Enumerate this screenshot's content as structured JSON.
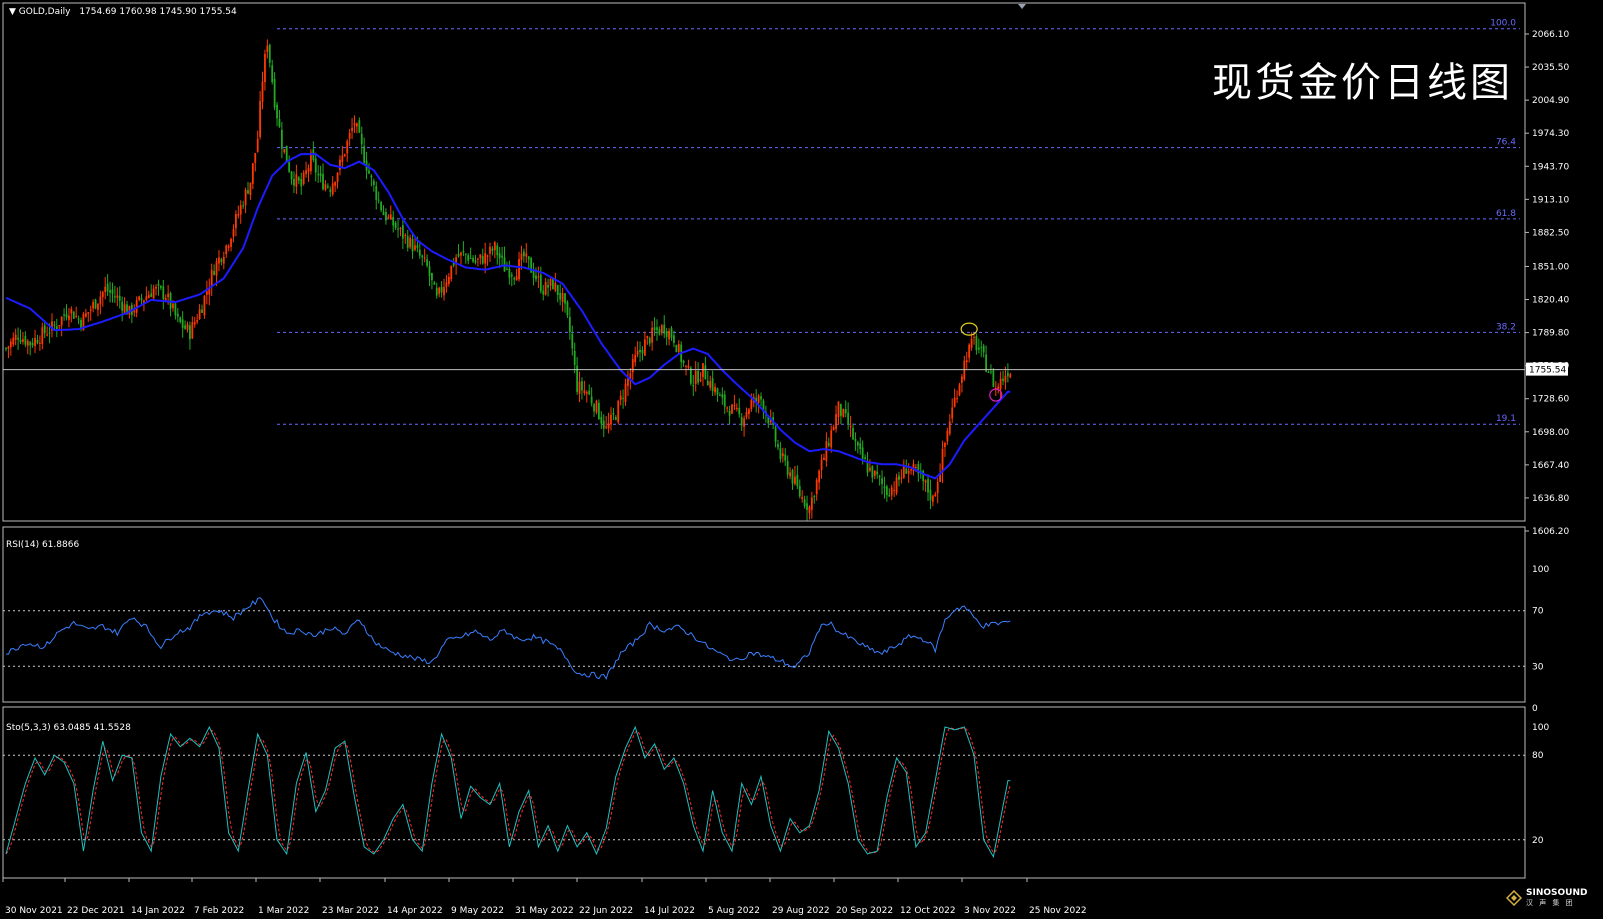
{
  "header": {
    "symbol_label": "GOLD,Daily",
    "ohlc": "1754.69 1760.98 1745.90 1755.54"
  },
  "watermark": "现货金价日线图",
  "logo": {
    "name": "SINOSOUND",
    "sub": "汉 声 集 团"
  },
  "rsi": {
    "label": "RSI(14) 61.8866",
    "levels": [
      30,
      70
    ],
    "max": 100,
    "min": 0
  },
  "stoch": {
    "label": "Sto(5,3,3) 63.0485 41.5528",
    "levels": [
      20,
      80
    ],
    "max": 100
  },
  "colors": {
    "up_candle": "#ff3a00",
    "down_candle": "#22aa22",
    "ma": "#1c1cff",
    "fib": "#6a6aff",
    "rsi": "#3a7fff",
    "stoch_main": "#20c0c0",
    "stoch_signal": "#ff2a2a",
    "price_line": "#c0c0c0"
  },
  "chart_data": {
    "type": "line",
    "title": "现货金价日线图",
    "current_price": 1755.54,
    "current_price_label": "1755.54",
    "price_axis": {
      "ylim": [
        1598,
        2074
      ],
      "ticks": [
        2066.1,
        2035.5,
        2004.9,
        1974.3,
        1943.7,
        1913.1,
        1882.5,
        1851.0,
        1820.4,
        1789.8,
        1759.2,
        1728.6,
        1698.0,
        1667.4,
        1636.8,
        1606.2
      ],
      "tick_labels": [
        "2066.10",
        "2035.50",
        "2004.90",
        "1974.30",
        "1943.70",
        "1913.10",
        "1882.50",
        "1851.00",
        "1820.40",
        "1789.80",
        "1759.20",
        "1728.60",
        "1698.00",
        "1667.40",
        "1636.80",
        "1606.20"
      ]
    },
    "x_tick_labels": [
      "30 Nov 2021",
      "22 Dec 2021",
      "14 Jan 2022",
      "7 Feb 2022",
      "1 Mar 2022",
      "23 Mar 2022",
      "14 Apr 2022",
      "9 May 2022",
      "31 May 2022",
      "22 Jun 2022",
      "14 Jul 2022",
      "5 Aug 2022",
      "29 Aug 2022",
      "20 Sep 2022",
      "12 Oct 2022",
      "3 Nov 2022",
      "25 Nov 2022"
    ],
    "fibonacci": [
      {
        "label": "100.0",
        "price": 2071
      },
      {
        "label": "76.4",
        "price": 1961
      },
      {
        "label": "61.8",
        "price": 1895
      },
      {
        "label": "38.2",
        "price": 1790
      },
      {
        "label": "19.1",
        "price": 1705
      }
    ],
    "price_anchors": [
      [
        0,
        1775
      ],
      [
        5,
        1788
      ],
      [
        10,
        1780
      ],
      [
        16,
        1790
      ],
      [
        21,
        1797
      ],
      [
        26,
        1812
      ],
      [
        31,
        1800
      ],
      [
        36,
        1815
      ],
      [
        41,
        1830
      ],
      [
        46,
        1822
      ],
      [
        51,
        1808
      ],
      [
        56,
        1820
      ],
      [
        61,
        1830
      ],
      [
        66,
        1825
      ],
      [
        71,
        1800
      ],
      [
        76,
        1790
      ],
      [
        81,
        1815
      ],
      [
        86,
        1850
      ],
      [
        91,
        1870
      ],
      [
        96,
        1900
      ],
      [
        101,
        1930
      ],
      [
        104,
        1970
      ],
      [
        106,
        2025
      ],
      [
        108,
        2060
      ],
      [
        111,
        2005
      ],
      [
        114,
        1965
      ],
      [
        118,
        1935
      ],
      [
        122,
        1925
      ],
      [
        126,
        1950
      ],
      [
        130,
        1930
      ],
      [
        134,
        1925
      ],
      [
        138,
        1945
      ],
      [
        141,
        1965
      ],
      [
        144,
        1985
      ],
      [
        147,
        1960
      ],
      [
        151,
        1930
      ],
      [
        156,
        1900
      ],
      [
        162,
        1885
      ],
      [
        168,
        1870
      ],
      [
        174,
        1850
      ],
      [
        178,
        1820
      ],
      [
        182,
        1840
      ],
      [
        186,
        1860
      ],
      [
        190,
        1862
      ],
      [
        194,
        1855
      ],
      [
        198,
        1860
      ],
      [
        202,
        1868
      ],
      [
        206,
        1850
      ],
      [
        210,
        1845
      ],
      [
        214,
        1860
      ],
      [
        218,
        1845
      ],
      [
        222,
        1830
      ],
      [
        226,
        1835
      ],
      [
        230,
        1820
      ],
      [
        233,
        1790
      ],
      [
        236,
        1740
      ],
      [
        240,
        1735
      ],
      [
        244,
        1720
      ],
      [
        248,
        1700
      ],
      [
        252,
        1715
      ],
      [
        256,
        1740
      ],
      [
        260,
        1765
      ],
      [
        264,
        1780
      ],
      [
        268,
        1790
      ],
      [
        272,
        1795
      ],
      [
        276,
        1785
      ],
      [
        280,
        1760
      ],
      [
        284,
        1745
      ],
      [
        288,
        1755
      ],
      [
        292,
        1740
      ],
      [
        296,
        1725
      ],
      [
        300,
        1718
      ],
      [
        304,
        1710
      ],
      [
        308,
        1725
      ],
      [
        312,
        1728
      ],
      [
        316,
        1705
      ],
      [
        320,
        1675
      ],
      [
        324,
        1660
      ],
      [
        328,
        1640
      ],
      [
        332,
        1628
      ],
      [
        336,
        1660
      ],
      [
        340,
        1690
      ],
      [
        344,
        1720
      ],
      [
        348,
        1705
      ],
      [
        352,
        1680
      ],
      [
        356,
        1665
      ],
      [
        360,
        1655
      ],
      [
        364,
        1643
      ],
      [
        368,
        1650
      ],
      [
        372,
        1665
      ],
      [
        376,
        1660
      ],
      [
        380,
        1648
      ],
      [
        383,
        1635
      ],
      [
        386,
        1665
      ],
      [
        390,
        1710
      ],
      [
        394,
        1745
      ],
      [
        397,
        1770
      ],
      [
        400,
        1782
      ],
      [
        403,
        1770
      ],
      [
        406,
        1755
      ],
      [
        409,
        1738
      ],
      [
        412,
        1748
      ],
      [
        414,
        1755
      ]
    ],
    "ma_anchors": [
      [
        0,
        1822
      ],
      [
        10,
        1812
      ],
      [
        20,
        1792
      ],
      [
        30,
        1793
      ],
      [
        40,
        1800
      ],
      [
        50,
        1808
      ],
      [
        60,
        1820
      ],
      [
        70,
        1818
      ],
      [
        80,
        1825
      ],
      [
        90,
        1840
      ],
      [
        98,
        1868
      ],
      [
        104,
        1905
      ],
      [
        110,
        1935
      ],
      [
        116,
        1948
      ],
      [
        122,
        1955
      ],
      [
        128,
        1955
      ],
      [
        134,
        1945
      ],
      [
        140,
        1942
      ],
      [
        146,
        1948
      ],
      [
        152,
        1940
      ],
      [
        158,
        1920
      ],
      [
        164,
        1895
      ],
      [
        170,
        1875
      ],
      [
        176,
        1865
      ],
      [
        182,
        1858
      ],
      [
        190,
        1850
      ],
      [
        198,
        1848
      ],
      [
        206,
        1852
      ],
      [
        214,
        1850
      ],
      [
        222,
        1845
      ],
      [
        230,
        1835
      ],
      [
        238,
        1810
      ],
      [
        246,
        1780
      ],
      [
        254,
        1755
      ],
      [
        260,
        1742
      ],
      [
        266,
        1748
      ],
      [
        272,
        1760
      ],
      [
        278,
        1770
      ],
      [
        284,
        1775
      ],
      [
        290,
        1770
      ],
      [
        296,
        1755
      ],
      [
        302,
        1742
      ],
      [
        308,
        1730
      ],
      [
        314,
        1715
      ],
      [
        320,
        1700
      ],
      [
        326,
        1688
      ],
      [
        332,
        1680
      ],
      [
        338,
        1682
      ],
      [
        344,
        1680
      ],
      [
        350,
        1675
      ],
      [
        356,
        1670
      ],
      [
        362,
        1668
      ],
      [
        368,
        1668
      ],
      [
        374,
        1665
      ],
      [
        380,
        1658
      ],
      [
        384,
        1655
      ],
      [
        390,
        1668
      ],
      [
        396,
        1690
      ],
      [
        402,
        1705
      ],
      [
        408,
        1720
      ],
      [
        414,
        1735
      ]
    ],
    "rsi_anchors": [
      [
        0,
        39
      ],
      [
        8,
        47
      ],
      [
        16,
        44
      ],
      [
        22,
        55
      ],
      [
        28,
        61
      ],
      [
        34,
        56
      ],
      [
        40,
        59
      ],
      [
        46,
        54
      ],
      [
        52,
        66
      ],
      [
        58,
        58
      ],
      [
        64,
        44
      ],
      [
        70,
        54
      ],
      [
        76,
        58
      ],
      [
        82,
        69
      ],
      [
        88,
        70
      ],
      [
        94,
        65
      ],
      [
        100,
        73
      ],
      [
        106,
        79
      ],
      [
        110,
        65
      ],
      [
        116,
        54
      ],
      [
        122,
        56
      ],
      [
        128,
        52
      ],
      [
        134,
        58
      ],
      [
        140,
        53
      ],
      [
        146,
        64
      ],
      [
        152,
        48
      ],
      [
        158,
        41
      ],
      [
        164,
        38
      ],
      [
        170,
        35
      ],
      [
        176,
        33
      ],
      [
        182,
        48
      ],
      [
        188,
        51
      ],
      [
        194,
        55
      ],
      [
        200,
        49
      ],
      [
        206,
        56
      ],
      [
        212,
        49
      ],
      [
        218,
        51
      ],
      [
        224,
        47
      ],
      [
        230,
        40
      ],
      [
        236,
        25
      ],
      [
        242,
        24
      ],
      [
        248,
        22
      ],
      [
        254,
        39
      ],
      [
        260,
        48
      ],
      [
        266,
        60
      ],
      [
        272,
        56
      ],
      [
        278,
        58
      ],
      [
        284,
        52
      ],
      [
        290,
        44
      ],
      [
        296,
        38
      ],
      [
        302,
        34
      ],
      [
        308,
        40
      ],
      [
        314,
        37
      ],
      [
        320,
        34
      ],
      [
        326,
        29
      ],
      [
        332,
        40
      ],
      [
        336,
        57
      ],
      [
        340,
        62
      ],
      [
        344,
        55
      ],
      [
        350,
        49
      ],
      [
        356,
        43
      ],
      [
        362,
        39
      ],
      [
        368,
        45
      ],
      [
        374,
        52
      ],
      [
        380,
        49
      ],
      [
        384,
        42
      ],
      [
        388,
        63
      ],
      [
        392,
        71
      ],
      [
        396,
        73
      ],
      [
        400,
        65
      ],
      [
        404,
        59
      ],
      [
        410,
        61
      ],
      [
        414,
        62
      ]
    ],
    "stoch_anchors": [
      [
        0,
        10
      ],
      [
        4,
        35
      ],
      [
        8,
        60
      ],
      [
        12,
        78
      ],
      [
        16,
        66
      ],
      [
        20,
        80
      ],
      [
        24,
        75
      ],
      [
        28,
        60
      ],
      [
        32,
        12
      ],
      [
        36,
        55
      ],
      [
        40,
        90
      ],
      [
        44,
        62
      ],
      [
        48,
        80
      ],
      [
        52,
        78
      ],
      [
        56,
        25
      ],
      [
        60,
        12
      ],
      [
        64,
        65
      ],
      [
        68,
        95
      ],
      [
        72,
        86
      ],
      [
        76,
        92
      ],
      [
        80,
        86
      ],
      [
        84,
        100
      ],
      [
        88,
        85
      ],
      [
        92,
        25
      ],
      [
        96,
        12
      ],
      [
        100,
        55
      ],
      [
        104,
        95
      ],
      [
        108,
        80
      ],
      [
        112,
        20
      ],
      [
        116,
        10
      ],
      [
        120,
        60
      ],
      [
        124,
        82
      ],
      [
        128,
        40
      ],
      [
        132,
        55
      ],
      [
        136,
        85
      ],
      [
        140,
        90
      ],
      [
        144,
        50
      ],
      [
        148,
        15
      ],
      [
        152,
        10
      ],
      [
        156,
        20
      ],
      [
        160,
        35
      ],
      [
        164,
        45
      ],
      [
        168,
        20
      ],
      [
        172,
        12
      ],
      [
        176,
        60
      ],
      [
        180,
        95
      ],
      [
        184,
        78
      ],
      [
        188,
        35
      ],
      [
        192,
        58
      ],
      [
        196,
        50
      ],
      [
        200,
        45
      ],
      [
        204,
        60
      ],
      [
        208,
        15
      ],
      [
        212,
        40
      ],
      [
        216,
        55
      ],
      [
        220,
        15
      ],
      [
        224,
        30
      ],
      [
        228,
        12
      ],
      [
        232,
        30
      ],
      [
        236,
        15
      ],
      [
        240,
        25
      ],
      [
        244,
        10
      ],
      [
        248,
        28
      ],
      [
        252,
        65
      ],
      [
        256,
        85
      ],
      [
        260,
        100
      ],
      [
        264,
        78
      ],
      [
        268,
        88
      ],
      [
        272,
        70
      ],
      [
        276,
        78
      ],
      [
        280,
        60
      ],
      [
        284,
        30
      ],
      [
        288,
        12
      ],
      [
        292,
        55
      ],
      [
        296,
        25
      ],
      [
        300,
        12
      ],
      [
        304,
        60
      ],
      [
        308,
        45
      ],
      [
        312,
        65
      ],
      [
        316,
        30
      ],
      [
        320,
        12
      ],
      [
        324,
        35
      ],
      [
        328,
        25
      ],
      [
        332,
        30
      ],
      [
        336,
        55
      ],
      [
        340,
        97
      ],
      [
        344,
        85
      ],
      [
        348,
        60
      ],
      [
        352,
        20
      ],
      [
        356,
        10
      ],
      [
        360,
        12
      ],
      [
        364,
        50
      ],
      [
        368,
        78
      ],
      [
        372,
        68
      ],
      [
        376,
        15
      ],
      [
        380,
        25
      ],
      [
        384,
        62
      ],
      [
        388,
        100
      ],
      [
        392,
        98
      ],
      [
        396,
        100
      ],
      [
        400,
        80
      ],
      [
        404,
        20
      ],
      [
        408,
        8
      ],
      [
        414,
        62
      ]
    ]
  }
}
